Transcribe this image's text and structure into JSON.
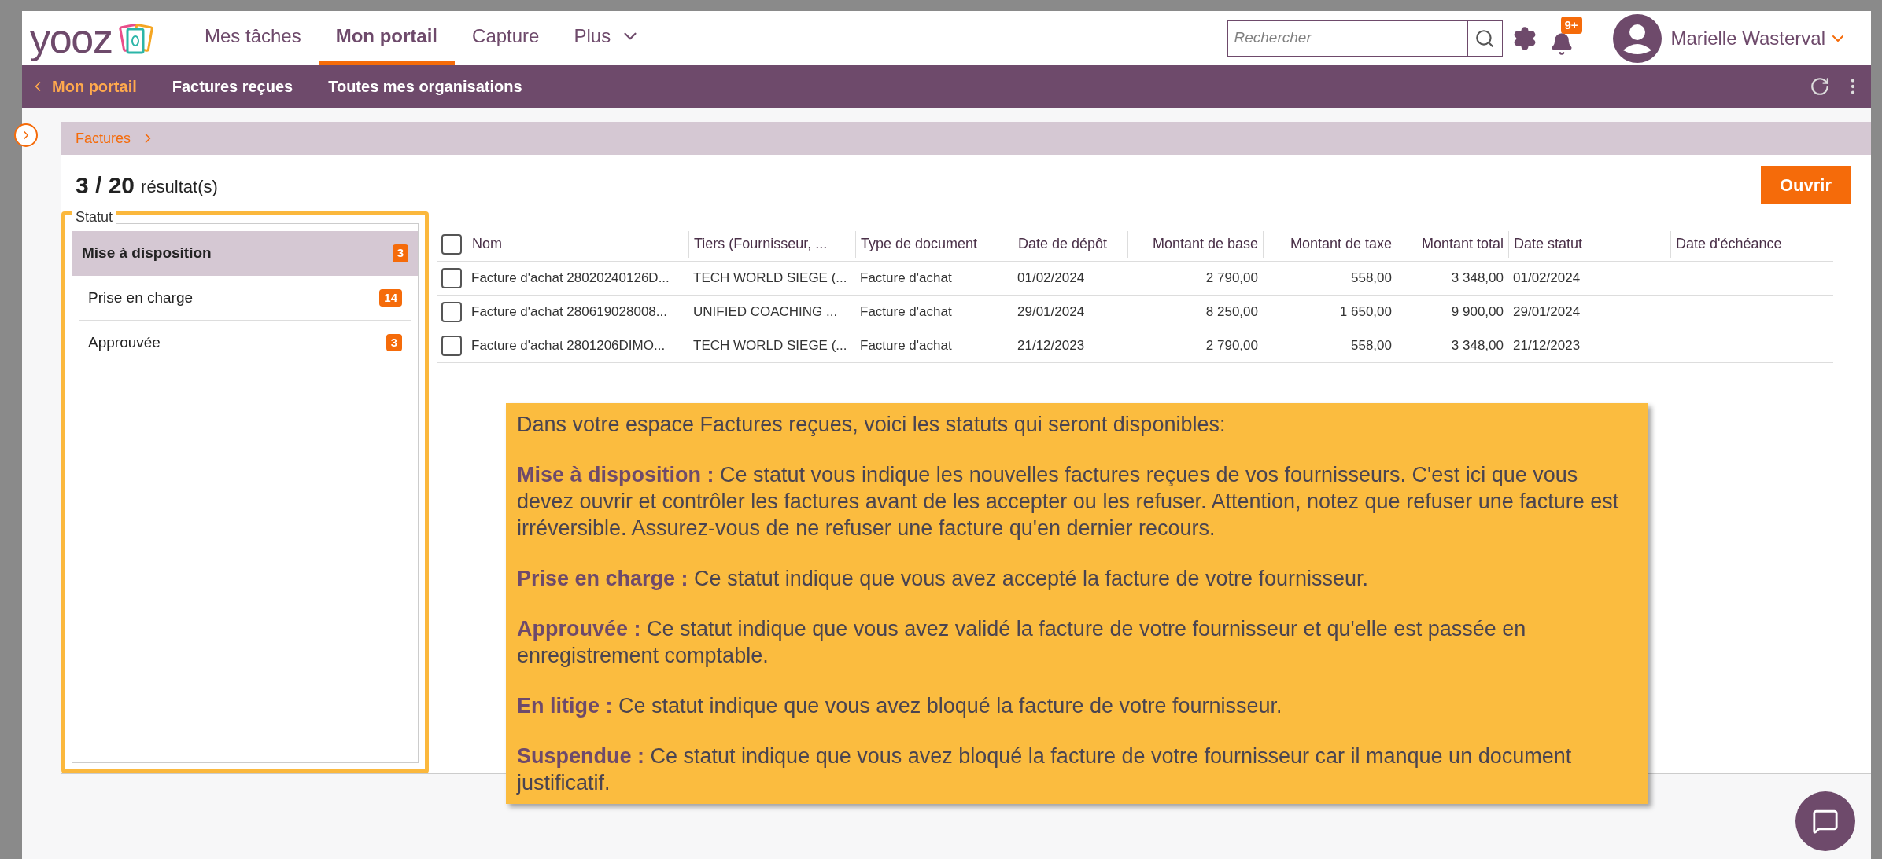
{
  "header": {
    "logo": "yooz",
    "nav": [
      {
        "label": "Mes tâches",
        "selected": false,
        "dropdown": false
      },
      {
        "label": "Mon portail",
        "selected": true,
        "dropdown": false
      },
      {
        "label": "Capture",
        "selected": false,
        "dropdown": false
      },
      {
        "label": "Plus",
        "selected": false,
        "dropdown": true
      }
    ],
    "search": {
      "placeholder": "Rechercher"
    },
    "notifications_badge": "9+",
    "user": "Marielle Wasterval"
  },
  "subnav": {
    "back": "Mon portail",
    "items": [
      "Factures reçues",
      "Toutes mes organisations"
    ]
  },
  "breadcrumb": "Factures",
  "results": {
    "count": "3 / 20",
    "label": "résultat(s)"
  },
  "open_button": "Ouvrir",
  "filter": {
    "title": "Statut",
    "items": [
      {
        "label": "Mise à disposition",
        "count": "3",
        "selected": true
      },
      {
        "label": "Prise en charge",
        "count": "14",
        "selected": false
      },
      {
        "label": "Approuvée",
        "count": "3",
        "selected": false
      }
    ]
  },
  "table": {
    "select_all_checked": false,
    "columns": [
      "Nom",
      "Tiers (Fournisseur, ...",
      "Type de document",
      "Date de dépôt",
      "Montant de base",
      "Montant de taxe",
      "Montant total",
      "Date statut",
      "Date d'échéance"
    ],
    "rows": [
      {
        "checked": false,
        "cells": [
          "Facture d'achat 28020240126D...",
          "TECH WORLD SIEGE (...",
          "Facture d'achat",
          "01/02/2024",
          "2 790,00",
          "558,00",
          "3 348,00",
          "01/02/2024",
          ""
        ]
      },
      {
        "checked": false,
        "cells": [
          "Facture d'achat 280619028008...",
          "UNIFIED COACHING ...",
          "Facture d'achat",
          "29/01/2024",
          "8 250,00",
          "1 650,00",
          "9 900,00",
          "29/01/2024",
          ""
        ]
      },
      {
        "checked": false,
        "cells": [
          "Facture d'achat 2801206DIMO...",
          "TECH WORLD SIEGE (...",
          "Facture d'achat",
          "21/12/2023",
          "2 790,00",
          "558,00",
          "3 348,00",
          "21/12/2023",
          ""
        ]
      }
    ]
  },
  "tooltip": [
    "Dans votre espace Factures reçues, voici les statuts qui seront disponibles:",
    "**Mise à disposition :** Ce statut vous indique les nouvelles factures reçues de vos fournisseurs. C'est ici que vous devez ouvrir et contrôler les factures avant de les accepter ou les refuser. Attention, notez que refuser une facture est irréversible. Assurez-vous de ne refuser une facture qu'en dernier recours.",
    "**Prise en charge :** Ce statut indique que vous avez accepté la facture de votre fournisseur.",
    "**Approuvée :** Ce statut indique que vous avez validé la facture de votre fournisseur et qu'elle est passée en enregistrement comptable.",
    "**En litige :** Ce statut indique que vous avez bloqué la facture de votre fournisseur.",
    "**Suspendue :** Ce statut indique que vous avez bloqué la facture de votre fournisseur car il manque un document justificatif."
  ]
}
